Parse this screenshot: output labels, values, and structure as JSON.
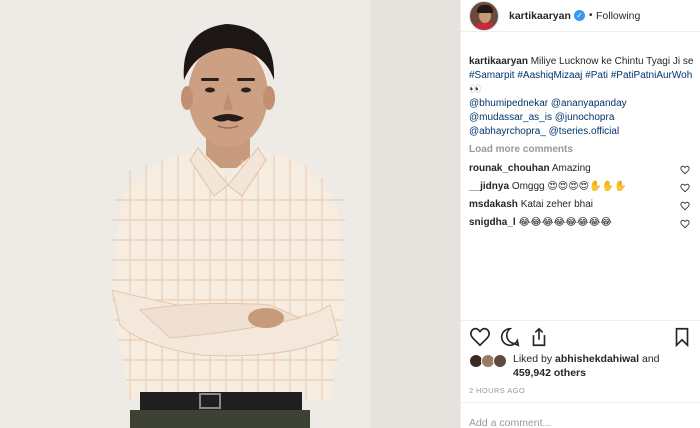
{
  "header": {
    "username": "kartikaaryan",
    "separator": "•",
    "follow_status": "Following",
    "verified_icon": "verified-badge-icon"
  },
  "caption": {
    "username": "kartikaaryan",
    "text": "Miliye Lucknow ke Chintu Tyagi Ji se",
    "hashtags": "#Samarpit #AashiqMizaaj #Pati #PatiPatniAurWoh",
    "emoji": "👀",
    "mentions_line1": "@bhumipednekar @ananyapanday",
    "mentions_line2": "@mudassar_as_is @junochopra",
    "mentions_line3": "@abhayrchopra_ @tseries.official"
  },
  "load_more": "Load more comments",
  "comments": [
    {
      "user": "rounak_chouhan",
      "text": "Amazing"
    },
    {
      "user": "__jidnya",
      "text": "Omggg 😍😍😍😍✋✋✋"
    },
    {
      "user": "msdakash",
      "text": "Katai zeher bhai"
    },
    {
      "user": "snigdha_l",
      "text": "😂😂😂😂😂😂😂😂"
    }
  ],
  "likes": {
    "prefix": "Liked by",
    "liker": "abhishekdahiwal",
    "and": "and",
    "count": "459,942 others"
  },
  "timestamp": "2 HOURS AGO",
  "add_comment_placeholder": "Add a comment...",
  "colors": {
    "link": "#003569",
    "verified": "#3897f0",
    "muted": "#999999"
  }
}
